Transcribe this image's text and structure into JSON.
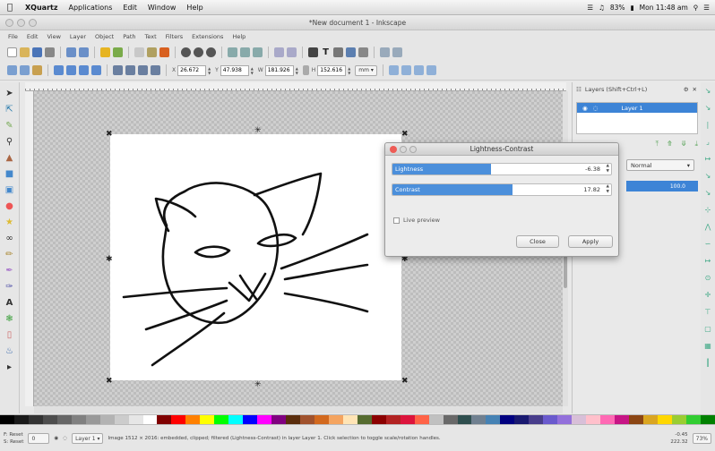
{
  "mac_menu": {
    "app": "XQuartz",
    "items": [
      "Applications",
      "Edit",
      "Window",
      "Help"
    ],
    "clock": "Mon 11:48 am",
    "battery": "83%"
  },
  "window_title": "*New document 1 - Inkscape",
  "menu": [
    "File",
    "Edit",
    "View",
    "Layer",
    "Object",
    "Path",
    "Text",
    "Filters",
    "Extensions",
    "Help"
  ],
  "controls": {
    "x_label": "X",
    "x_value": "26.672",
    "y_label": "Y",
    "y_value": "47.938",
    "w_label": "W",
    "w_value": "181.926",
    "h_label": "H",
    "h_value": "152.616",
    "unit": "mm"
  },
  "layers_panel": {
    "title": "Layers (Shift+Ctrl+L)",
    "layer_name": "Layer 1",
    "blend_mode": "Normal",
    "opacity": "100.0"
  },
  "dialog": {
    "title": "Lightness-Contrast",
    "lightness_label": "Lightness",
    "lightness_value": "-6.38",
    "lightness_fill": 0.45,
    "contrast_label": "Contrast",
    "contrast_value": "17.82",
    "contrast_fill": 0.55,
    "live_preview_label": "Live preview",
    "close_label": "Close",
    "apply_label": "Apply"
  },
  "palette_colors": [
    "#000000",
    "#1a1a1a",
    "#333333",
    "#4d4d4d",
    "#666666",
    "#808080",
    "#999999",
    "#b3b3b3",
    "#cccccc",
    "#e6e6e6",
    "#ffffff",
    "#800000",
    "#ff0000",
    "#ff8000",
    "#ffff00",
    "#00ff00",
    "#00ffff",
    "#0000ff",
    "#ff00ff",
    "#800080",
    "#5a2d0c",
    "#a0522d",
    "#d2691e",
    "#f4a460",
    "#ffe4b5",
    "#556b2f",
    "#8b0000",
    "#b22222",
    "#dc143c",
    "#ff6347",
    "#c0c0c0",
    "#696969",
    "#2f4f4f",
    "#708090",
    "#4682b4",
    "#000080",
    "#191970",
    "#483d8b",
    "#6a5acd",
    "#9370db",
    "#d8bfd8",
    "#ffc0cb",
    "#ff69b4",
    "#c71585",
    "#8b4513",
    "#daa520",
    "#ffd700",
    "#9acd32",
    "#32cd32",
    "#008000"
  ],
  "status": {
    "fill_label": "Reset",
    "stroke_label": "Reset",
    "opacity_value": "0",
    "layer": "Layer 1",
    "message": "Image 1512 × 2016: embedded, clipped; filtered (Lightness-Contrast) in layer Layer 1. Click selection to toggle scale/rotation handles.",
    "x_coord": "-0.45",
    "y_coord": "222.32",
    "zoom": "73%"
  }
}
